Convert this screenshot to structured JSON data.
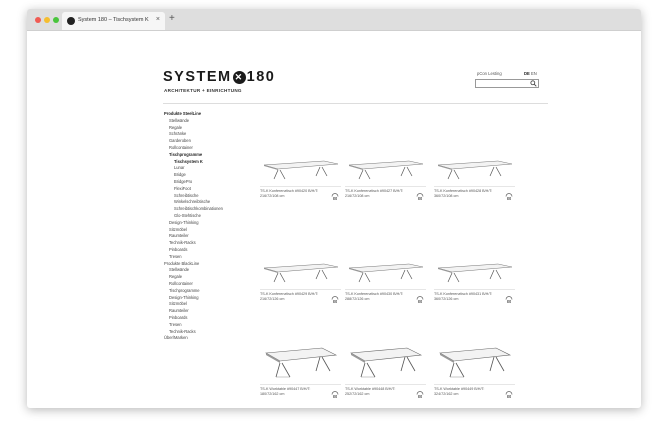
{
  "browser": {
    "tab_title": "System 180 – Tischsystem K",
    "close_glyph": "×",
    "new_tab_glyph": "+"
  },
  "header": {
    "logo_left": "SYSTEM",
    "logo_mark": "✕",
    "logo_right": "180",
    "subtitle": "ARCHITEKTUR + EINRICHTUNG",
    "pcon_link": "pCon Lesting",
    "lang_de": "DE",
    "lang_en": "EN",
    "search_placeholder": "",
    "search_icon": "magnifier-icon"
  },
  "sidebar": {
    "items": [
      {
        "label": "Produkte SteelLine",
        "level": 0,
        "bold": true
      },
      {
        "label": "Stellwände",
        "level": 1
      },
      {
        "label": "Regale",
        "level": 1
      },
      {
        "label": "Schränke",
        "level": 1
      },
      {
        "label": "Garderoben",
        "level": 1
      },
      {
        "label": "Rollcontainer",
        "level": 1
      },
      {
        "label": "Tischprogramme",
        "level": 1,
        "bold": true
      },
      {
        "label": "Tischsystem K",
        "level": 2,
        "bold": true
      },
      {
        "label": "Lunar",
        "level": 2
      },
      {
        "label": "Bridge",
        "level": 2
      },
      {
        "label": "BridgePro",
        "level": 2
      },
      {
        "label": "FlexiFoot",
        "level": 2
      },
      {
        "label": "Schreibtische",
        "level": 2
      },
      {
        "label": "Winkelschreibtische",
        "level": 2
      },
      {
        "label": "Schreibtischkombinationen",
        "level": 2
      },
      {
        "label": "Glo-Stehtische",
        "level": 2
      },
      {
        "label": "Design-Thinking",
        "level": 1
      },
      {
        "label": "Sitzmöbel",
        "level": 1
      },
      {
        "label": "Raumteiler",
        "level": 1
      },
      {
        "label": "Technik-Racks",
        "level": 1
      },
      {
        "label": "Pinboards",
        "level": 1
      },
      {
        "label": "Tresen",
        "level": 1
      },
      {
        "label": "Produkte BlackLine",
        "level": 0
      },
      {
        "label": "Stellwände",
        "level": 1
      },
      {
        "label": "Regale",
        "level": 1
      },
      {
        "label": "Rollcontainer",
        "level": 1
      },
      {
        "label": "Tischprogramme",
        "level": 1
      },
      {
        "label": "Design-Thinking",
        "level": 1
      },
      {
        "label": "Sitzmöbel",
        "level": 1
      },
      {
        "label": "Raumteiler",
        "level": 1
      },
      {
        "label": "Pinboards",
        "level": 1
      },
      {
        "label": "Tresen",
        "level": 1
      },
      {
        "label": "Technik-Racks",
        "level": 1
      },
      {
        "label": "Über/Marken",
        "level": 0
      }
    ]
  },
  "products": [
    {
      "caption": "TS-K Konferenztisch #90420 B/H/T: 216/72/108 cm",
      "icon": "3d-configurator-icon"
    },
    {
      "caption": "TS-K Konferenztisch #90427 B/H/T: 216/72/108 cm",
      "icon": "3d-configurator-icon"
    },
    {
      "caption": "TS-K Konferenztisch #90428 B/H/T: 360/72/108 cm",
      "icon": "3d-configurator-icon"
    },
    {
      "caption": "TS-K Konferenztisch #90429 B/H/T: 216/72/126 cm",
      "icon": "3d-configurator-icon"
    },
    {
      "caption": "TS-K Konferenztisch #90430 B/H/T: 288/72/126 cm",
      "icon": "3d-configurator-icon"
    },
    {
      "caption": "TS-K Konferenztisch #90431 B/H/T: 360/72/126 cm",
      "icon": "3d-configurator-icon"
    },
    {
      "caption": "TS-K Worktable #90447 B/H/T: 180/72/162 cm",
      "icon": "3d-configurator-icon"
    },
    {
      "caption": "TS-K Worktable #90448 B/H/T: 252/72/162 cm",
      "icon": "3d-configurator-icon"
    },
    {
      "caption": "TS-K Worktable #90449 B/H/T: 324/72/162 cm",
      "icon": "3d-configurator-icon"
    }
  ]
}
